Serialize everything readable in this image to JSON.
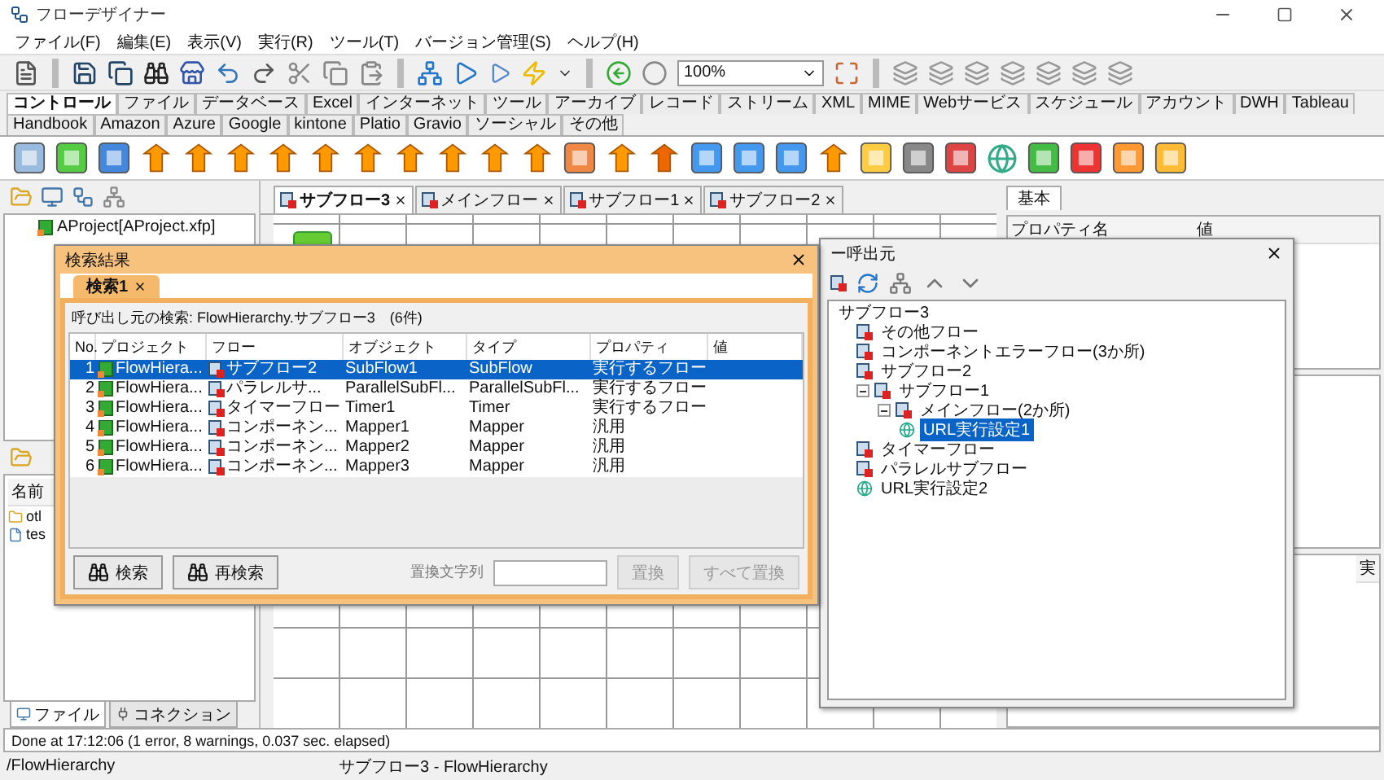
{
  "window": {
    "title": "フローデザイナー"
  },
  "menu": [
    "ファイル(F)",
    "編集(E)",
    "表示(V)",
    "実行(R)",
    "ツール(T)",
    "バージョン管理(S)",
    "ヘルプ(H)"
  ],
  "toolbar": {
    "zoom": "100%"
  },
  "palette_tabs": [
    {
      "label": "コントロール",
      "selected": true
    },
    {
      "label": "ファイル",
      "selected": false
    },
    {
      "label": "データベース",
      "selected": false
    },
    {
      "label": "Excel",
      "selected": false
    },
    {
      "label": "インターネット",
      "selected": false
    },
    {
      "label": "ツール",
      "selected": false
    },
    {
      "label": "アーカイブ",
      "selected": false
    },
    {
      "label": "レコード",
      "selected": false
    },
    {
      "label": "ストリーム",
      "selected": false
    },
    {
      "label": "XML",
      "selected": false
    },
    {
      "label": "MIME",
      "selected": false
    },
    {
      "label": "Webサービス",
      "selected": false
    },
    {
      "label": "スケジュール",
      "selected": false
    },
    {
      "label": "アカウント",
      "selected": false
    },
    {
      "label": "DWH",
      "selected": false
    },
    {
      "label": "Tableau",
      "selected": false
    },
    {
      "label": "Handbook",
      "selected": false
    },
    {
      "label": "Amazon",
      "selected": false
    },
    {
      "label": "Azure",
      "selected": false
    },
    {
      "label": "Google",
      "selected": false
    },
    {
      "label": "kintone",
      "selected": false
    },
    {
      "label": "Platio",
      "selected": false
    },
    {
      "label": "Gravio",
      "selected": false
    },
    {
      "label": "ソーシャル",
      "selected": false
    },
    {
      "label": "その他",
      "selected": false
    }
  ],
  "left_panel": {
    "tree": [
      {
        "label": "AProject[AProject.xfp]"
      }
    ],
    "file_list": {
      "header": "名前",
      "items": [
        {
          "label": "otl",
          "kind": "folder"
        },
        {
          "label": "tes",
          "kind": "file"
        }
      ]
    },
    "tabs": [
      {
        "label": "ファイル",
        "selected": true
      },
      {
        "label": "コネクション",
        "selected": false
      }
    ]
  },
  "editor_tabs": [
    {
      "label": "サブフロー3",
      "selected": true
    },
    {
      "label": "メインフロー",
      "selected": false
    },
    {
      "label": "サブフロー1",
      "selected": false
    },
    {
      "label": "サブフロー2",
      "selected": false
    }
  ],
  "properties_panel": {
    "tabs": [
      {
        "label": "基本",
        "selected": true
      }
    ],
    "columns": [
      "プロパティ名",
      "値"
    ],
    "lower_column": "実"
  },
  "search_dialog": {
    "title": "検索結果",
    "tabs": [
      {
        "label": "検索1",
        "selected": true
      }
    ],
    "caption": "呼び出し元の検索: FlowHierarchy.サブフロー3　(6件)",
    "columns": [
      "No.",
      "プロジェクト",
      "フロー",
      "オブジェクト",
      "タイプ",
      "プロパティ",
      "値"
    ],
    "rows": [
      {
        "no": "1",
        "project": "FlowHiera...",
        "flow": "サブフロー2",
        "object": "SubFlow1",
        "type": "SubFlow",
        "property": "実行するフロー",
        "selected": true
      },
      {
        "no": "2",
        "project": "FlowHiera...",
        "flow": "パラレルサ...",
        "object": "ParallelSubFl...",
        "type": "ParallelSubFl...",
        "property": "実行するフロー",
        "selected": false
      },
      {
        "no": "3",
        "project": "FlowHiera...",
        "flow": "タイマーフロー",
        "object": "Timer1",
        "type": "Timer",
        "property": "実行するフロー",
        "selected": false
      },
      {
        "no": "4",
        "project": "FlowHiera...",
        "flow": "コンポーネン...",
        "object": "Mapper1",
        "type": "Mapper",
        "property": "汎用",
        "selected": false
      },
      {
        "no": "5",
        "project": "FlowHiera...",
        "flow": "コンポーネン...",
        "object": "Mapper2",
        "type": "Mapper",
        "property": "汎用",
        "selected": false
      },
      {
        "no": "6",
        "project": "FlowHiera...",
        "flow": "コンポーネン...",
        "object": "Mapper3",
        "type": "Mapper",
        "property": "汎用",
        "selected": false
      }
    ],
    "buttons": [
      {
        "label": "検索",
        "disabled": false
      },
      {
        "label": "再検索",
        "disabled": false
      },
      {
        "label": "置換",
        "disabled": true
      },
      {
        "label": "すべて置換",
        "disabled": true
      }
    ],
    "replace_label": "置換文字列"
  },
  "caller_dialog": {
    "title": "ー呼出元",
    "tree": [
      {
        "label": "サブフロー3",
        "selected": false,
        "children": [
          {
            "label": "その他フロー",
            "kind": "flow",
            "selected": false
          },
          {
            "label": "コンポーネントエラーフロー(3か所)",
            "kind": "flow",
            "selected": false
          },
          {
            "label": "サブフロー2",
            "kind": "flow",
            "selected": false
          },
          {
            "label": "サブフロー1",
            "kind": "flow",
            "selected": false,
            "expanded": true,
            "children": [
              {
                "label": "メインフロー(2か所)",
                "kind": "flow",
                "selected": false,
                "expanded": true,
                "children": [
                  {
                    "label": "URL実行設定1",
                    "kind": "url",
                    "selected": true
                  }
                ]
              }
            ]
          },
          {
            "label": "タイマーフロー",
            "kind": "flow",
            "selected": false
          },
          {
            "label": "パラレルサブフロー",
            "kind": "flow",
            "selected": false
          },
          {
            "label": "URL実行設定2",
            "kind": "url",
            "selected": false
          }
        ]
      }
    ]
  },
  "log": {
    "line": "Done at 17:12:06 (1 error, 8 warnings, 0.037 sec. elapsed)"
  },
  "status_bar": [
    "/FlowHierarchy",
    "サブフロー3 - FlowHierarchy"
  ]
}
